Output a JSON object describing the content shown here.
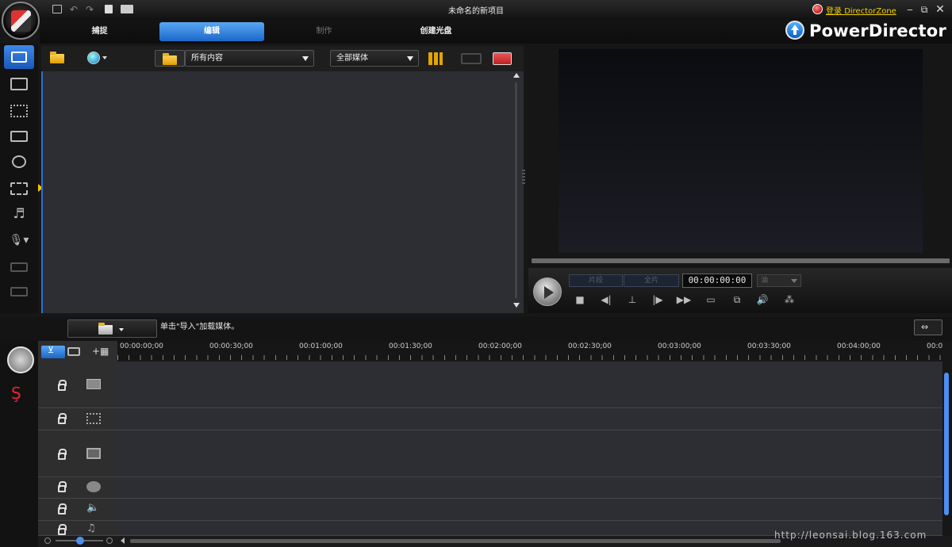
{
  "window": {
    "title": "未命名的新项目",
    "login_label": "登录",
    "director_zone": "DirectorZone"
  },
  "tabs": [
    {
      "label": "捕捉",
      "state": "normal"
    },
    {
      "label": "编辑",
      "state": "active"
    },
    {
      "label": "制作",
      "state": "disabled"
    },
    {
      "label": "创建光盘",
      "state": "normal"
    }
  ],
  "brand": "PowerDirector",
  "library": {
    "filter_value": "所有内容",
    "media_type_value": "全部媒体"
  },
  "preview": {
    "mode_clip": "片段",
    "mode_full": "全片",
    "timecode": "00:00:00:00",
    "zoom_value": "油"
  },
  "timeline": {
    "hint": "单击\"导入\"加载媒体。",
    "ruler_labels": [
      "00:00:00;00",
      "00:00:30;00",
      "00:01:00;00",
      "00:01:30;00",
      "00:02:00;00",
      "00:02:30;00",
      "00:03:00;00",
      "00:03:30;00",
      "00:04:00;00",
      "00:0"
    ],
    "tracks": [
      "video",
      "effect",
      "pip",
      "title",
      "voice",
      "music"
    ]
  },
  "watermark": "http://leonsai.blog.163.com",
  "colors": {
    "accent": "#2a74d8",
    "library_bg": "#2c2e33",
    "login_link": "#f5d000"
  }
}
